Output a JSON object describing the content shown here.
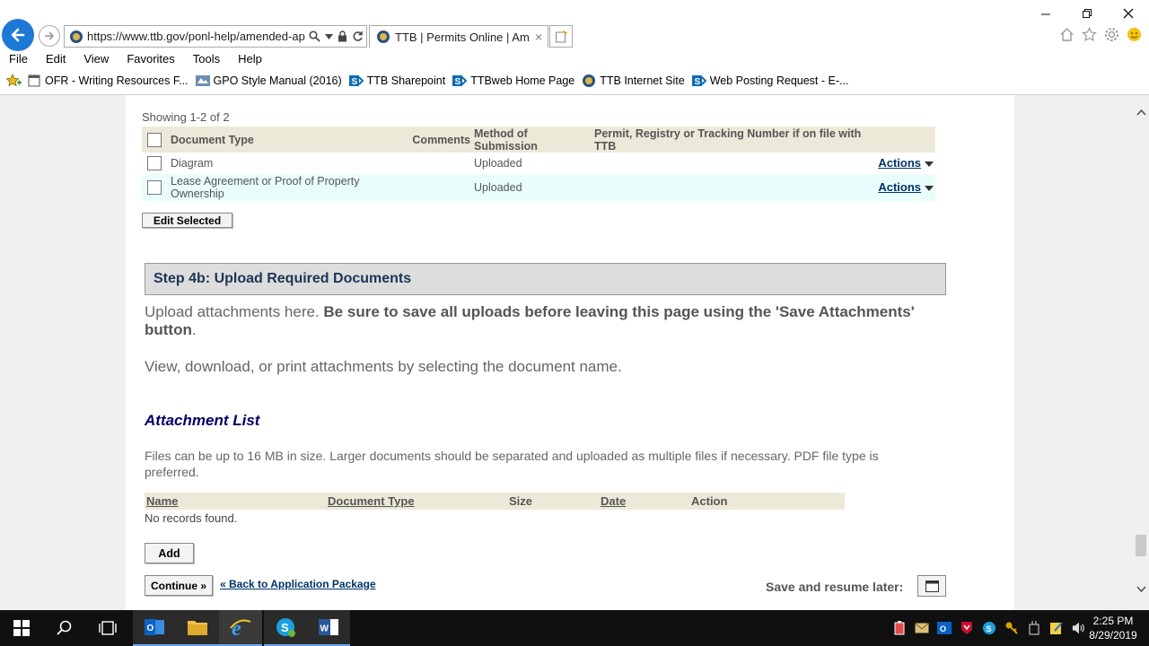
{
  "browser": {
    "url": "https://www.ttb.gov/ponl-help/amended-app",
    "tab_title": "TTB | Permits Online | Ame...",
    "tab_close": "×",
    "menu": [
      "File",
      "Edit",
      "View",
      "Favorites",
      "Tools",
      "Help"
    ],
    "favorites": [
      {
        "label": "OFR - Writing Resources F...",
        "icon": "page-icon"
      },
      {
        "label": "GPO Style Manual (2016)",
        "icon": "gpo-icon"
      },
      {
        "label": "TTB Sharepoint",
        "icon": "sharepoint-icon"
      },
      {
        "label": "TTBweb Home Page",
        "icon": "sharepoint-icon"
      },
      {
        "label": "TTB Internet Site",
        "icon": "ttb-seal-icon"
      },
      {
        "label": "Web Posting Request - E-...",
        "icon": "sharepoint-icon"
      }
    ]
  },
  "documents": {
    "showing": "Showing 1-2 of 2",
    "headers": {
      "doc_type": "Document Type",
      "comments": "Comments",
      "method": "Method of Submission",
      "permit": "Permit, Registry or Tracking Number if on file with TTB"
    },
    "rows": [
      {
        "doc_type": "Diagram",
        "comments": "",
        "method": "Uploaded",
        "permit": "",
        "actions": "Actions"
      },
      {
        "doc_type": "Lease Agreement or Proof of Property Ownership",
        "comments": "",
        "method": "Uploaded",
        "permit": "",
        "actions": "Actions"
      }
    ],
    "edit_selected": "Edit Selected"
  },
  "step4b": {
    "title": "Step 4b: Upload Required Documents",
    "intro_plain": "Upload attachments here. ",
    "intro_bold": "Be sure to save all uploads before leaving this page using the 'Save Attachments' button",
    "intro_end": ".",
    "view_text": "View, download, or print attachments by selecting the document name."
  },
  "attachments": {
    "title": "Attachment List",
    "note": "Files can be up to 16 MB in size. Larger documents should be separated and uploaded as multiple files if necessary. PDF file type is preferred.",
    "headers": {
      "name": "Name",
      "doc_type": "Document Type",
      "size": "Size",
      "date": "Date",
      "action": "Action"
    },
    "empty": "No records found.",
    "add": "Add"
  },
  "footer": {
    "continue": "Continue »",
    "back": "« Back to Application Package",
    "save_later": "Save and resume later:"
  },
  "taskbar": {
    "time": "2:25 PM",
    "date": "8/29/2019"
  },
  "colors": {
    "header_bg": "#ece9d8",
    "alt_row": "#eafdfd",
    "link": "#003366",
    "step_title": "#1c3557",
    "section_title": "#000066",
    "ie_blue": "#1e79d6"
  }
}
